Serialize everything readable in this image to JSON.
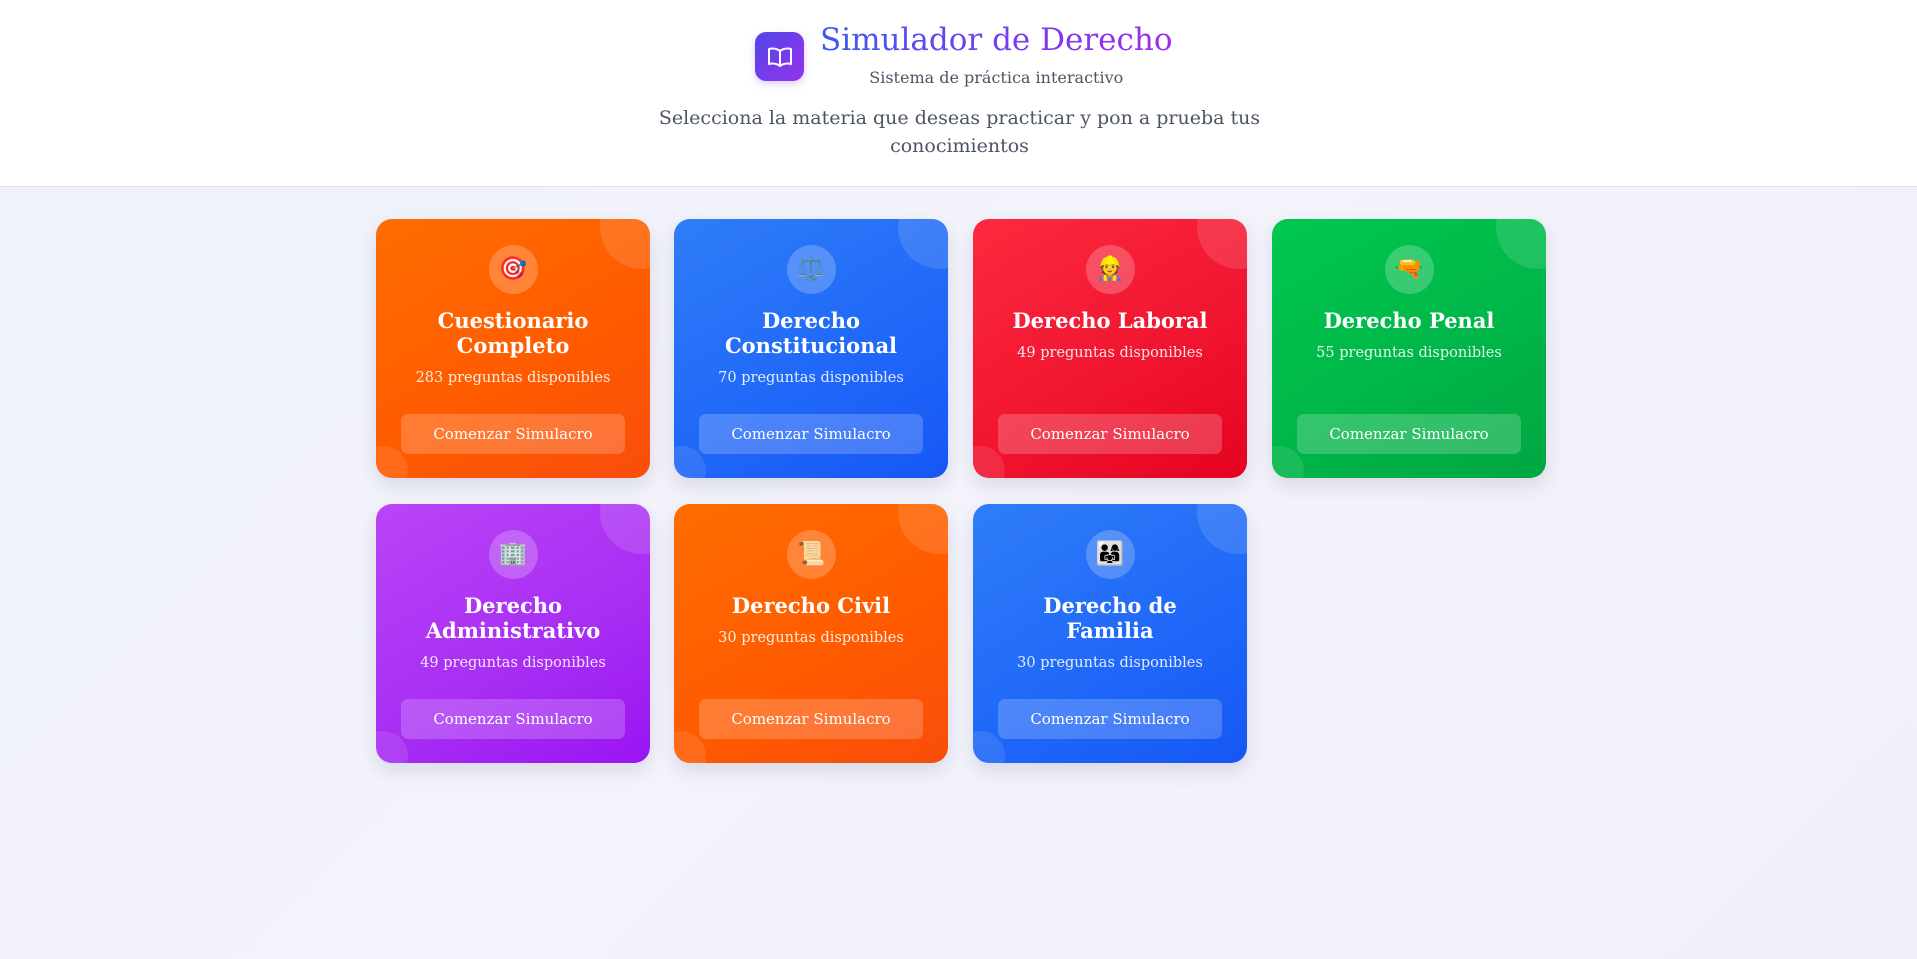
{
  "header": {
    "title": "Simulador de Derecho",
    "subtitle": "Sistema de práctica interactivo",
    "intro": "Selecciona la materia que deseas practicar y pon a prueba tus conocimientos",
    "logo_icon": "open-book-icon"
  },
  "colors": {
    "orange": "#ff6200",
    "blue": "#2370f8",
    "red": "#f41533",
    "green": "#00bb4b",
    "purple": "#ad2ff5"
  },
  "cards": [
    {
      "icon": "🎯",
      "icon_name": "target-icon",
      "title": "Cuestionario Completo",
      "count": "283 preguntas disponibles",
      "button": "Comenzar Simulacro",
      "color": "orange"
    },
    {
      "icon": "⚖️",
      "icon_name": "scales-icon",
      "title": "Derecho Constitucional",
      "count": "70 preguntas disponibles",
      "button": "Comenzar Simulacro",
      "color": "blue"
    },
    {
      "icon": "👷",
      "icon_name": "construction-worker-icon",
      "title": "Derecho Laboral",
      "count": "49 preguntas disponibles",
      "button": "Comenzar Simulacro",
      "color": "red"
    },
    {
      "icon": "🔫",
      "icon_name": "water-pistol-icon",
      "title": "Derecho Penal",
      "count": "55 preguntas disponibles",
      "button": "Comenzar Simulacro",
      "color": "green"
    },
    {
      "icon": "🏢",
      "icon_name": "office-building-icon",
      "title": "Derecho Administrativo",
      "count": "49 preguntas disponibles",
      "button": "Comenzar Simulacro",
      "color": "purple"
    },
    {
      "icon": "📜",
      "icon_name": "scroll-icon",
      "title": "Derecho Civil",
      "count": "30 preguntas disponibles",
      "button": "Comenzar Simulacro",
      "color": "orange"
    },
    {
      "icon": "👨‍👩‍👧",
      "icon_name": "family-icon",
      "title": "Derecho de Familia",
      "count": "30 preguntas disponibles",
      "button": "Comenzar Simulacro",
      "color": "blue"
    }
  ]
}
